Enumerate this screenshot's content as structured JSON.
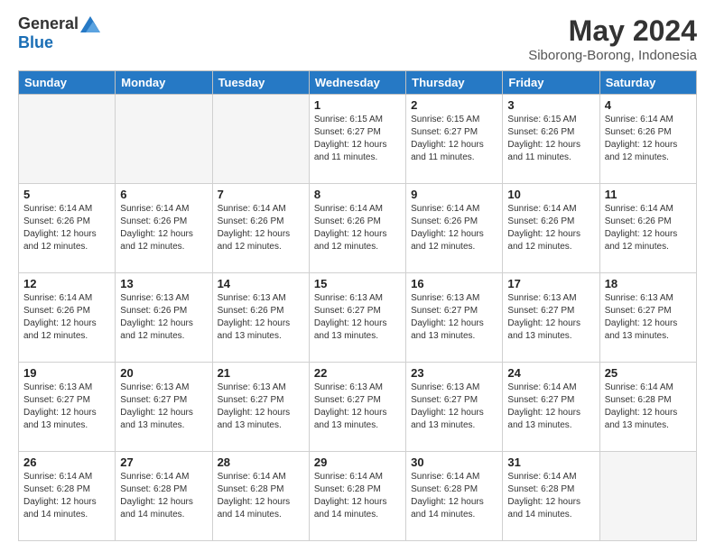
{
  "header": {
    "logo_general": "General",
    "logo_blue": "Blue",
    "month_title": "May 2024",
    "subtitle": "Siborong-Borong, Indonesia"
  },
  "days_of_week": [
    "Sunday",
    "Monday",
    "Tuesday",
    "Wednesday",
    "Thursday",
    "Friday",
    "Saturday"
  ],
  "weeks": [
    [
      {
        "day": "",
        "info": ""
      },
      {
        "day": "",
        "info": ""
      },
      {
        "day": "",
        "info": ""
      },
      {
        "day": "1",
        "info": "Sunrise: 6:15 AM\nSunset: 6:27 PM\nDaylight: 12 hours and 11 minutes."
      },
      {
        "day": "2",
        "info": "Sunrise: 6:15 AM\nSunset: 6:27 PM\nDaylight: 12 hours and 11 minutes."
      },
      {
        "day": "3",
        "info": "Sunrise: 6:15 AM\nSunset: 6:26 PM\nDaylight: 12 hours and 11 minutes."
      },
      {
        "day": "4",
        "info": "Sunrise: 6:14 AM\nSunset: 6:26 PM\nDaylight: 12 hours and 12 minutes."
      }
    ],
    [
      {
        "day": "5",
        "info": "Sunrise: 6:14 AM\nSunset: 6:26 PM\nDaylight: 12 hours and 12 minutes."
      },
      {
        "day": "6",
        "info": "Sunrise: 6:14 AM\nSunset: 6:26 PM\nDaylight: 12 hours and 12 minutes."
      },
      {
        "day": "7",
        "info": "Sunrise: 6:14 AM\nSunset: 6:26 PM\nDaylight: 12 hours and 12 minutes."
      },
      {
        "day": "8",
        "info": "Sunrise: 6:14 AM\nSunset: 6:26 PM\nDaylight: 12 hours and 12 minutes."
      },
      {
        "day": "9",
        "info": "Sunrise: 6:14 AM\nSunset: 6:26 PM\nDaylight: 12 hours and 12 minutes."
      },
      {
        "day": "10",
        "info": "Sunrise: 6:14 AM\nSunset: 6:26 PM\nDaylight: 12 hours and 12 minutes."
      },
      {
        "day": "11",
        "info": "Sunrise: 6:14 AM\nSunset: 6:26 PM\nDaylight: 12 hours and 12 minutes."
      }
    ],
    [
      {
        "day": "12",
        "info": "Sunrise: 6:14 AM\nSunset: 6:26 PM\nDaylight: 12 hours and 12 minutes."
      },
      {
        "day": "13",
        "info": "Sunrise: 6:13 AM\nSunset: 6:26 PM\nDaylight: 12 hours and 12 minutes."
      },
      {
        "day": "14",
        "info": "Sunrise: 6:13 AM\nSunset: 6:26 PM\nDaylight: 12 hours and 13 minutes."
      },
      {
        "day": "15",
        "info": "Sunrise: 6:13 AM\nSunset: 6:27 PM\nDaylight: 12 hours and 13 minutes."
      },
      {
        "day": "16",
        "info": "Sunrise: 6:13 AM\nSunset: 6:27 PM\nDaylight: 12 hours and 13 minutes."
      },
      {
        "day": "17",
        "info": "Sunrise: 6:13 AM\nSunset: 6:27 PM\nDaylight: 12 hours and 13 minutes."
      },
      {
        "day": "18",
        "info": "Sunrise: 6:13 AM\nSunset: 6:27 PM\nDaylight: 12 hours and 13 minutes."
      }
    ],
    [
      {
        "day": "19",
        "info": "Sunrise: 6:13 AM\nSunset: 6:27 PM\nDaylight: 12 hours and 13 minutes."
      },
      {
        "day": "20",
        "info": "Sunrise: 6:13 AM\nSunset: 6:27 PM\nDaylight: 12 hours and 13 minutes."
      },
      {
        "day": "21",
        "info": "Sunrise: 6:13 AM\nSunset: 6:27 PM\nDaylight: 12 hours and 13 minutes."
      },
      {
        "day": "22",
        "info": "Sunrise: 6:13 AM\nSunset: 6:27 PM\nDaylight: 12 hours and 13 minutes."
      },
      {
        "day": "23",
        "info": "Sunrise: 6:13 AM\nSunset: 6:27 PM\nDaylight: 12 hours and 13 minutes."
      },
      {
        "day": "24",
        "info": "Sunrise: 6:14 AM\nSunset: 6:27 PM\nDaylight: 12 hours and 13 minutes."
      },
      {
        "day": "25",
        "info": "Sunrise: 6:14 AM\nSunset: 6:28 PM\nDaylight: 12 hours and 13 minutes."
      }
    ],
    [
      {
        "day": "26",
        "info": "Sunrise: 6:14 AM\nSunset: 6:28 PM\nDaylight: 12 hours and 14 minutes."
      },
      {
        "day": "27",
        "info": "Sunrise: 6:14 AM\nSunset: 6:28 PM\nDaylight: 12 hours and 14 minutes."
      },
      {
        "day": "28",
        "info": "Sunrise: 6:14 AM\nSunset: 6:28 PM\nDaylight: 12 hours and 14 minutes."
      },
      {
        "day": "29",
        "info": "Sunrise: 6:14 AM\nSunset: 6:28 PM\nDaylight: 12 hours and 14 minutes."
      },
      {
        "day": "30",
        "info": "Sunrise: 6:14 AM\nSunset: 6:28 PM\nDaylight: 12 hours and 14 minutes."
      },
      {
        "day": "31",
        "info": "Sunrise: 6:14 AM\nSunset: 6:28 PM\nDaylight: 12 hours and 14 minutes."
      },
      {
        "day": "",
        "info": ""
      }
    ]
  ]
}
